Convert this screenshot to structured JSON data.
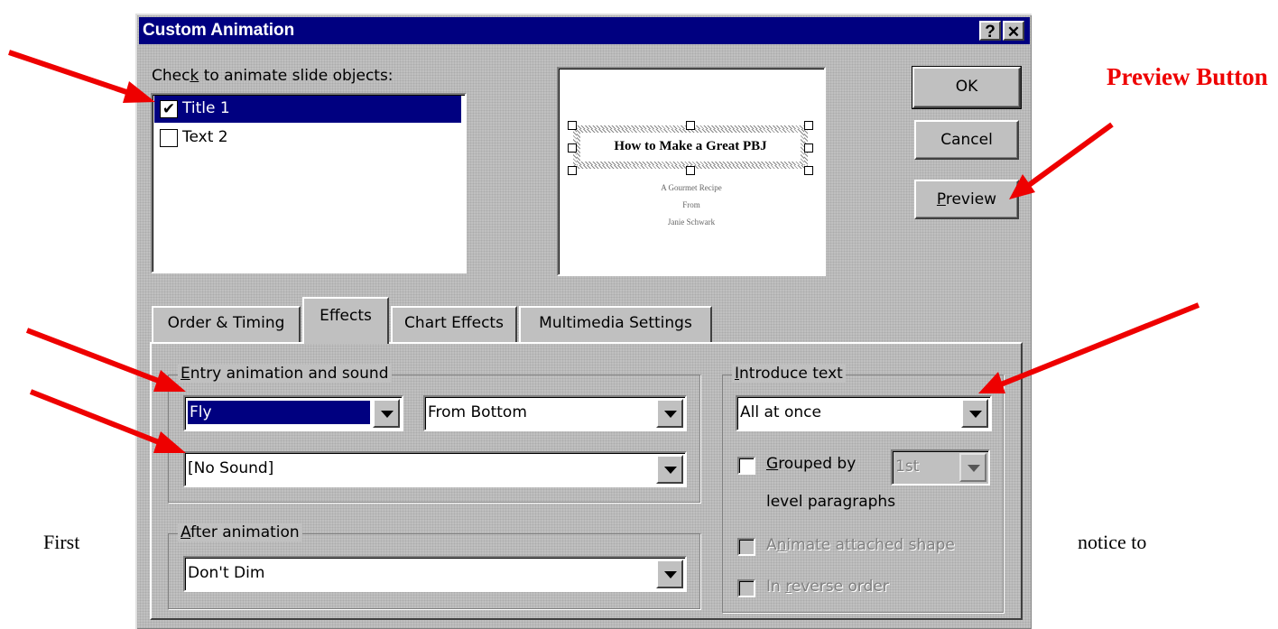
{
  "dialog": {
    "title": "Custom Animation",
    "help_glyph": "?",
    "close_glyph": "✕"
  },
  "objects": {
    "label_pre": "Chec",
    "label_ul": "k",
    "label_post": " to animate slide objects:",
    "items": [
      {
        "label": "Title 1",
        "checked": true,
        "selected": true
      },
      {
        "label": "Text 2",
        "checked": false,
        "selected": false
      }
    ]
  },
  "slide_preview": {
    "title": "How to Make a Great PBJ",
    "line1": "A Gourmet Recipe",
    "line2": "From",
    "line3": "Janie Schwark"
  },
  "buttons": {
    "ok": "OK",
    "cancel": "Cancel",
    "preview_ul": "P",
    "preview_rest": "review"
  },
  "tabs": [
    "Order & Timing",
    "Effects",
    "Chart Effects",
    "Multimedia Settings"
  ],
  "entry": {
    "group_ul": "E",
    "group_rest": "ntry animation and sound",
    "effect": "Fly",
    "direction": "From Bottom",
    "sound": "[No Sound]"
  },
  "after": {
    "group_ul": "A",
    "group_rest": "fter animation",
    "value": "Don't Dim"
  },
  "introduce": {
    "group_ul": "I",
    "group_rest": "ntroduce text",
    "value": "All at once",
    "grouped_ul": "G",
    "grouped_rest": "rouped by",
    "grouped_level": "1st",
    "level_paragraphs": "level paragraphs",
    "attached_pre": "A",
    "attached_ul": "n",
    "attached_rest": "imate attached shape",
    "reverse_pre": "In ",
    "reverse_ul": "r",
    "reverse_rest": "everse order"
  },
  "annotations": {
    "preview_button": "Preview  Button",
    "first": "First",
    "notice_to": "notice to"
  },
  "colors": {
    "arrow": "#ee0000",
    "titlebar": "#000080",
    "face": "#c0c0c0"
  }
}
